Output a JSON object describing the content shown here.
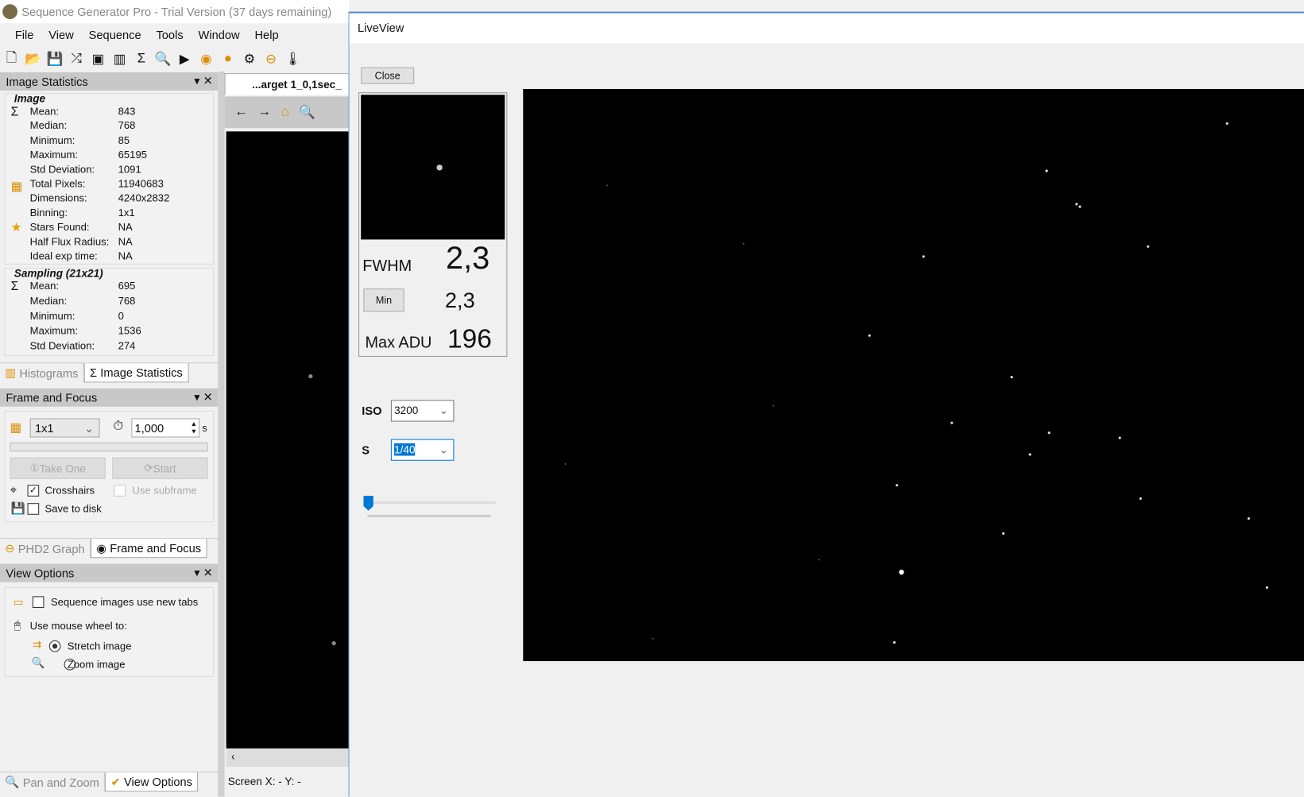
{
  "app": {
    "title": "Sequence Generator Pro - Trial Version (37 days remaining)",
    "menu": [
      "File",
      "View",
      "Sequence",
      "Tools",
      "Window",
      "Help"
    ]
  },
  "image_statistics": {
    "title": "Image Statistics",
    "image_section": "Image",
    "image_rows": [
      [
        "Mean:",
        "843"
      ],
      [
        "Median:",
        "768"
      ],
      [
        "Minimum:",
        "85"
      ],
      [
        "Maximum:",
        "65195"
      ],
      [
        "Std Deviation:",
        "1091"
      ],
      [
        "Total Pixels:",
        "11940683"
      ],
      [
        "Dimensions:",
        "4240x2832"
      ],
      [
        "Binning:",
        "1x1"
      ],
      [
        "Stars Found:",
        "NA"
      ],
      [
        "Half Flux Radius:",
        "NA"
      ],
      [
        "Ideal exp time:",
        "NA"
      ]
    ],
    "sampling_section": "Sampling (21x21)",
    "sampling_rows": [
      [
        "Mean:",
        "695"
      ],
      [
        "Median:",
        "768"
      ],
      [
        "Minimum:",
        "0"
      ],
      [
        "Maximum:",
        "1536"
      ],
      [
        "Std Deviation:",
        "274"
      ]
    ]
  },
  "tabs1": [
    "Histograms",
    "Image Statistics"
  ],
  "frame_focus": {
    "title": "Frame and Focus",
    "binning": "1x1",
    "exposure": "1,000",
    "unit": "s",
    "take_one": "Take One",
    "start": "Start",
    "crosshairs": "Crosshairs",
    "use_subframe": "Use subframe",
    "save_to_disk": "Save to disk"
  },
  "tabs2": [
    "PHD2 Graph",
    "Frame and Focus"
  ],
  "view_options": {
    "title": "View Options",
    "new_tabs": "Sequence images use new tabs",
    "wheel": "Use mouse wheel to:",
    "stretch": "Stretch image",
    "zoom": "Zoom image"
  },
  "tabs3": [
    "Pan and Zoom",
    "View Options"
  ],
  "doc_tab": "...arget 1_0,1sec_",
  "status": "Screen X: - Y: -",
  "liveview": {
    "title": "LiveView",
    "close": "Close",
    "fwhm_label": "FWHM",
    "fwhm": "2,3",
    "min_button": "Min",
    "min_value": "2,3",
    "maxadu_label": "Max ADU",
    "maxadu": "196",
    "iso_label": "ISO",
    "iso": "3200",
    "s_label": "S",
    "s": "1/40",
    "slider_value": 0
  }
}
